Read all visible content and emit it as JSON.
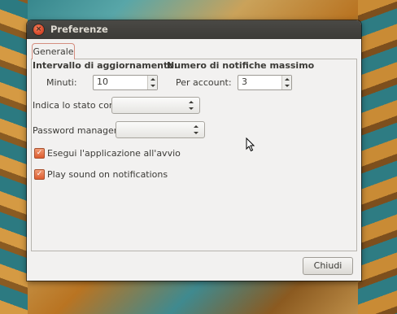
{
  "window": {
    "title": "Preferenze"
  },
  "tabs": [
    {
      "label": "Generale",
      "selected": true
    }
  ],
  "update_interval": {
    "heading": "Intervallo di aggiornamento:",
    "minutes_label": "Minuti:",
    "minutes_value": "10"
  },
  "max_notifications": {
    "heading": "Numero di notifiche massimo",
    "per_account_label": "Per account:",
    "per_account_value": "3"
  },
  "status": {
    "label": "Indica lo stato con:",
    "value": ""
  },
  "password_manager": {
    "label": "Password manager:",
    "value": ""
  },
  "checkboxes": [
    {
      "label": "Esegui l'applicazione all'avvio",
      "checked": true
    },
    {
      "label": "Play sound on notifications",
      "checked": true
    }
  ],
  "buttons": {
    "close_label": "Chiudi"
  },
  "colors": {
    "titlebar": "#3c3b37",
    "accent": "#dd5c2f",
    "window_bg": "#f2f1f0"
  }
}
